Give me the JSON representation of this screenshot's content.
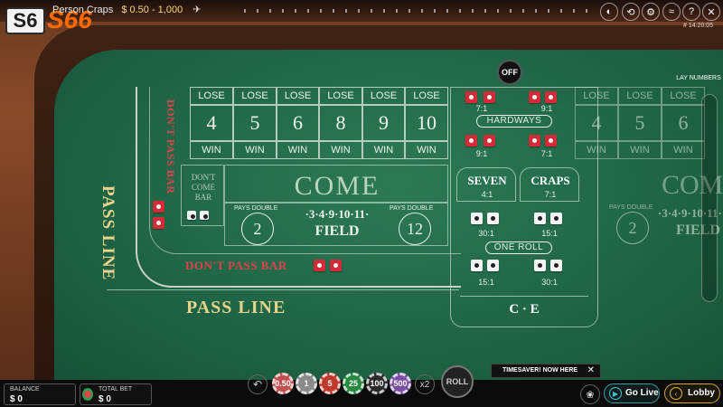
{
  "brand": {
    "logo_text": "S66"
  },
  "game": {
    "title": "Person Craps",
    "limits": "$ 0.50 - 1,000",
    "time": "# 14:20:05"
  },
  "header_icons": [
    "volume-icon",
    "history-icon",
    "settings-icon",
    "stats-icon",
    "help-icon",
    "close-icon"
  ],
  "off_puck": "OFF",
  "numbers": [
    "4",
    "5",
    "6",
    "8",
    "9",
    "10"
  ],
  "lose_label": "LOSE",
  "win_label": "WIN",
  "pass_line": "PASS LINE",
  "dont_pass_bar": "DON'T PASS BAR",
  "dont_come_bar": "DON'T COME BAR",
  "come": "COME",
  "field": {
    "pays_double": "PAYS DOUBLE",
    "left_number": "2",
    "right_number": "12",
    "numbers": "·3·4·9·10·11·",
    "label": "FIELD"
  },
  "hardways": {
    "label": "HARDWAYS",
    "top_left_pay": "7:1",
    "top_right_pay": "9:1",
    "bottom_left_pay": "9:1",
    "bottom_right_pay": "7:1"
  },
  "seven": {
    "label": "SEVEN",
    "pay": "4:1"
  },
  "craps": {
    "label": "CRAPS",
    "pay": "7:1"
  },
  "one_roll": {
    "label": "ONE ROLL",
    "pay_1": "30:1",
    "pay_2": "15:1",
    "pay_3": "15:1",
    "pay_4": "30:1"
  },
  "ce": "C · E",
  "lay_numbers": {
    "label": "LAY NUMBERS",
    "values": [
      "4",
      "5",
      "6"
    ]
  },
  "balance": {
    "label": "BALANCE",
    "value": "$ 0"
  },
  "total_bet": {
    "label": "TOTAL BET",
    "value": "$ 0"
  },
  "chips": [
    "0.50",
    "1",
    "5",
    "25",
    "100",
    "500"
  ],
  "double_label": "x2",
  "roll_label": "ROLL",
  "timesaver": "TIMESAVER! NOW HERE",
  "go_live": "Go Live",
  "lobby": "Lobby"
}
